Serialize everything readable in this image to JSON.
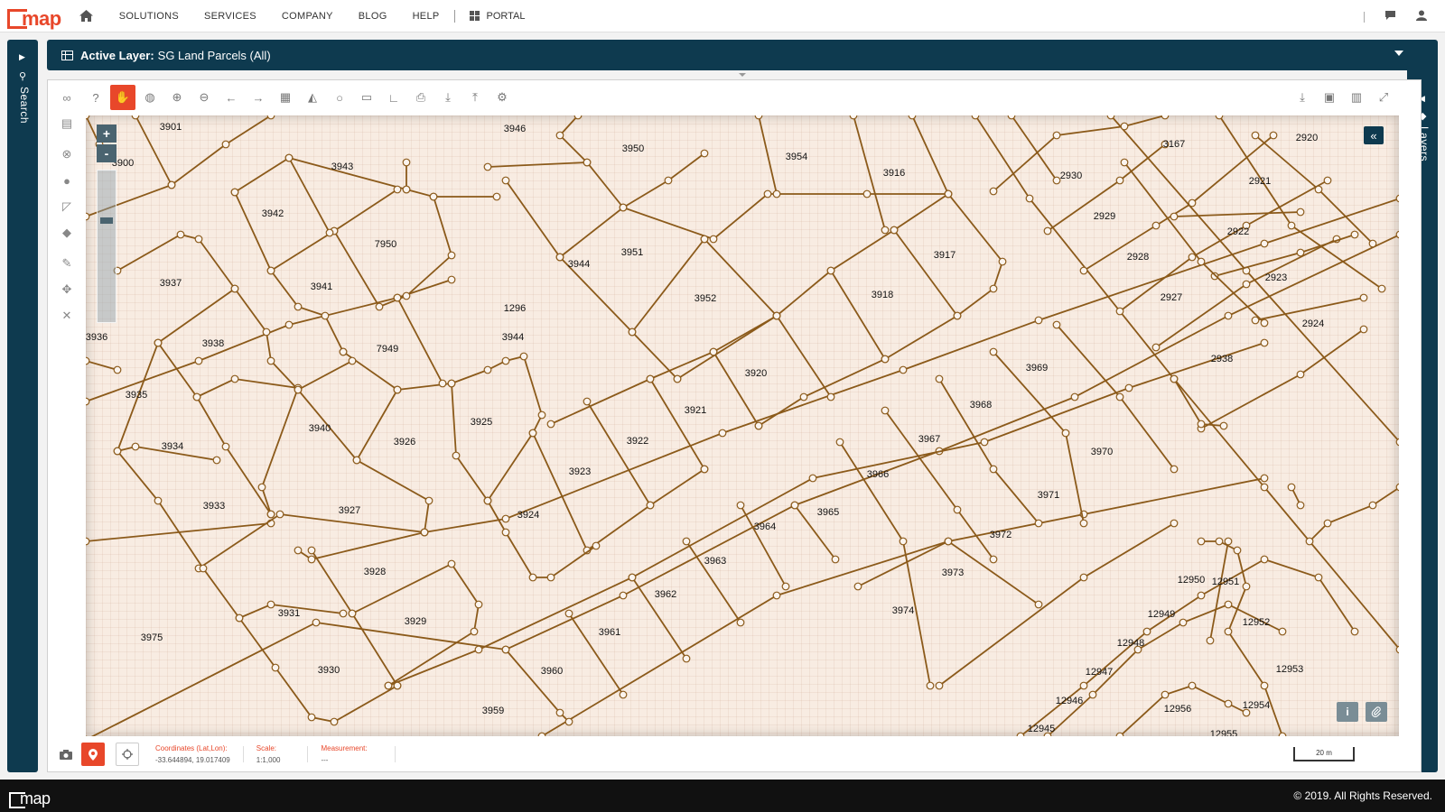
{
  "brand": {
    "logo_text": "map"
  },
  "nav": {
    "items": [
      "SOLUTIONS",
      "SERVICES",
      "COMPANY",
      "BLOG",
      "HELP"
    ],
    "portal": "PORTAL",
    "icons": {
      "home": "home-icon",
      "chat": "chat-icon",
      "user": "user-icon"
    }
  },
  "side_left": {
    "label": "Search"
  },
  "side_right": {
    "label": "Layers"
  },
  "layer_bar": {
    "prefix": "Active Layer:",
    "value": "SG Land Parcels (All)"
  },
  "toolbar": {
    "left_icons": [
      "help-icon",
      "pan-hand-icon",
      "globe-icon",
      "zoom-in-icon",
      "zoom-out-icon",
      "back-arrow-icon",
      "forward-arrow-icon",
      "table-icon",
      "chart-icon",
      "circle-icon",
      "ruler-icon",
      "angle-icon",
      "print-icon",
      "download-icon",
      "upload-icon",
      "settings-icon"
    ],
    "right_icons": [
      "export-icon",
      "image-icon",
      "columns-icon",
      "fullscreen-icon"
    ]
  },
  "left_tools": [
    "binoculars-icon",
    "map-icon",
    "clear-icon",
    "circle-draw-icon",
    "polygon-draw-icon",
    "eraser-icon",
    "edit-icon",
    "move-icon",
    "delete-icon"
  ],
  "map": {
    "zoom_in": "+",
    "zoom_out": "-",
    "collapse": "«",
    "info": "i",
    "parcel_labels": [
      "3901",
      "3900",
      "3946",
      "3950",
      "3954",
      "3916",
      "3167",
      "2920",
      "3943",
      "3942",
      "7950",
      "3944",
      "3951",
      "3952",
      "3917",
      "2930",
      "2921",
      "2929",
      "2922",
      "2928",
      "2923",
      "2927",
      "2924",
      "3937",
      "3941",
      "1296",
      "3918",
      "2938",
      "3936",
      "3938",
      "7949",
      "3944",
      "3920",
      "3969",
      "3935",
      "3921",
      "3968",
      "3940",
      "3926",
      "3925",
      "3922",
      "3967",
      "3970",
      "3934",
      "3923",
      "3966",
      "3933",
      "3927",
      "3924",
      "3965",
      "3971",
      "3964",
      "3972",
      "3928",
      "3963",
      "3973",
      "12950",
      "12951",
      "3962",
      "12949",
      "12952",
      "3931",
      "3929",
      "3961",
      "3974",
      "12948",
      "3975",
      "3930",
      "3960",
      "12947",
      "12953",
      "12946",
      "12956",
      "12954",
      "3959",
      "12945",
      "12955"
    ],
    "colors": {
      "parcel_line": "#8b5a1a",
      "background": "#f8ece2",
      "accent": "#e8472a",
      "panel": "#0e3a4f"
    }
  },
  "status": {
    "coords_label": "Coordinates (Lat,Lon):",
    "coords_value": "-33.644894, 19.017409",
    "scale_label": "Scale:",
    "scale_value": "1:1,000",
    "measurement_label": "Measurement:",
    "measurement_value": "---",
    "scalebar": "20 m"
  },
  "footer": {
    "copyright": "© 2019. All Rights Reserved."
  }
}
